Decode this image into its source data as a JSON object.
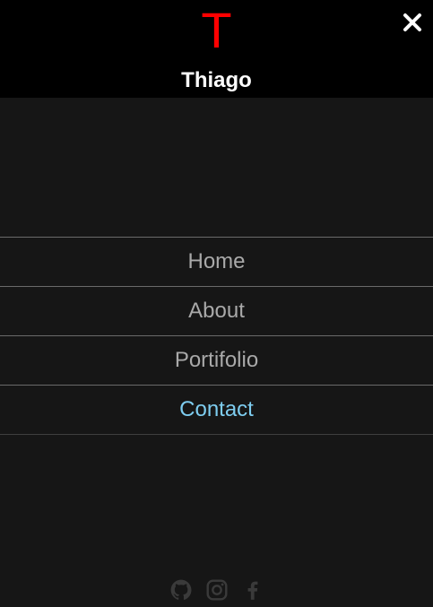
{
  "header": {
    "logo_letter": "T",
    "brand_name": "Thiago",
    "logo_color": "#ff0000",
    "close_icon": "close-icon"
  },
  "nav": {
    "items": [
      {
        "label": "Home",
        "active": false
      },
      {
        "label": "About",
        "active": false
      },
      {
        "label": "Portifolio",
        "active": false
      },
      {
        "label": "Contact",
        "active": true
      }
    ],
    "active_color": "#7ecdf0",
    "text_color": "#a9a9a9"
  },
  "social": {
    "icons": [
      "github-icon",
      "instagram-icon",
      "facebook-icon"
    ],
    "color": "#3a3a3a"
  }
}
